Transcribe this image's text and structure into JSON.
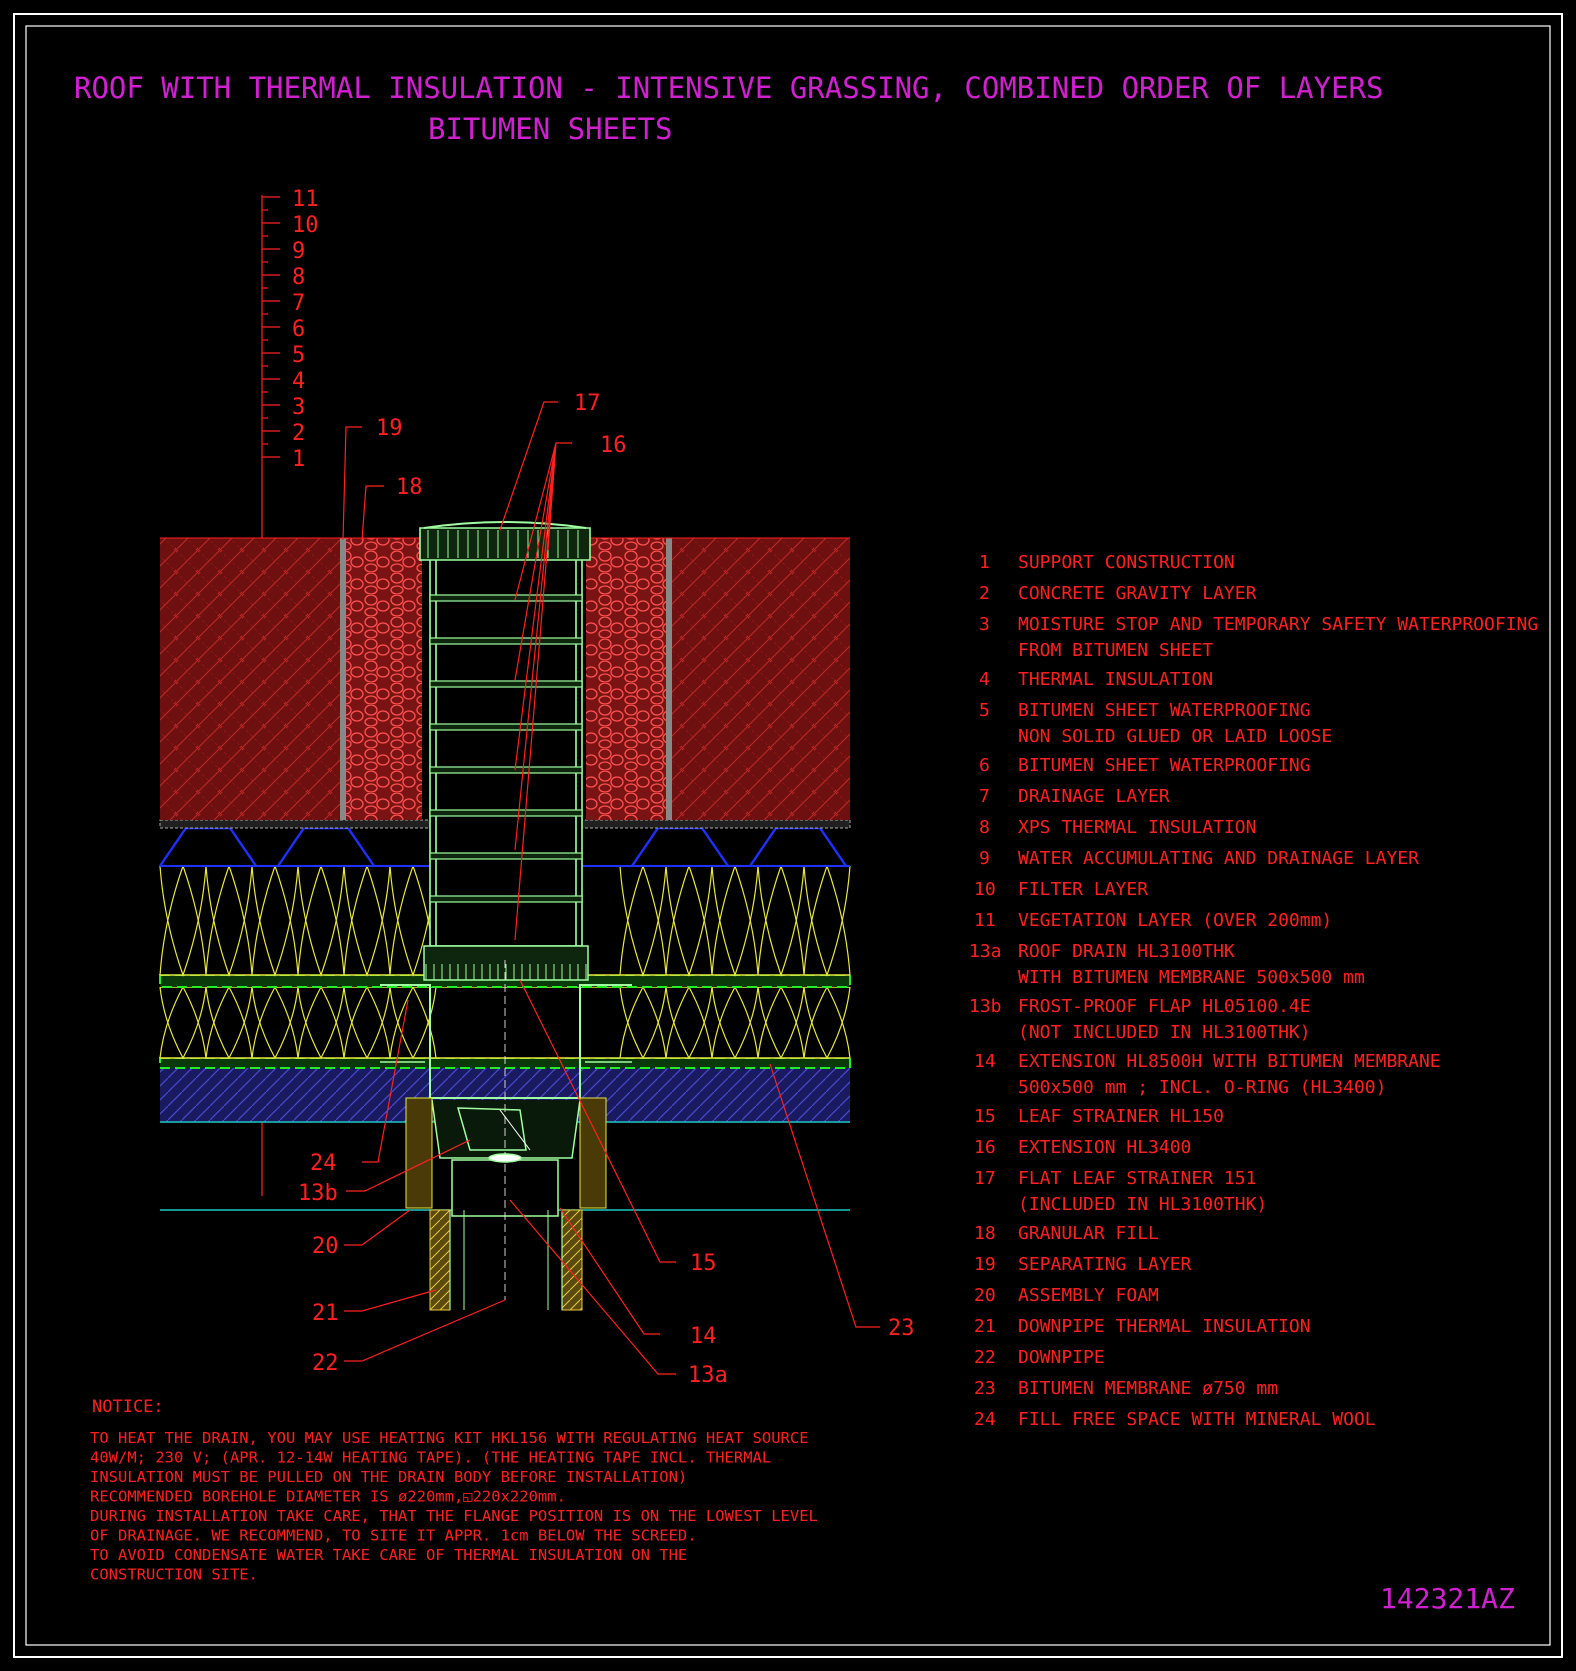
{
  "title_line1": "ROOF WITH THERMAL INSULATION - INTENSIVE GRASSING, COMBINED ORDER OF LAYERS",
  "title_line2": "BITUMEN SHEETS",
  "layer_scale_numbers": [
    "11",
    "10",
    "9",
    "8",
    "7",
    "6",
    "5",
    "4",
    "3",
    "2",
    "1"
  ],
  "callouts": {
    "c17": "17",
    "c16": "16",
    "c19": "19",
    "c18": "18",
    "c24": "24",
    "c13b": "13b",
    "c20": "20",
    "c21": "21",
    "c22": "22",
    "c15": "15",
    "c14": "14",
    "c13a": "13a",
    "c23": "23"
  },
  "legend": [
    {
      "num": "1",
      "lines": [
        "SUPPORT CONSTRUCTION"
      ]
    },
    {
      "num": "2",
      "lines": [
        "CONCRETE GRAVITY LAYER"
      ]
    },
    {
      "num": "3",
      "lines": [
        "MOISTURE STOP AND TEMPORARY SAFETY WATERPROOFING",
        "FROM BITUMEN SHEET"
      ]
    },
    {
      "num": "4",
      "lines": [
        "THERMAL INSULATION"
      ]
    },
    {
      "num": "5",
      "lines": [
        "BITUMEN SHEET WATERPROOFING",
        "NON SOLID GLUED OR LAID LOOSE"
      ]
    },
    {
      "num": "6",
      "lines": [
        "BITUMEN SHEET WATERPROOFING"
      ]
    },
    {
      "num": "7",
      "lines": [
        "DRAINAGE LAYER"
      ]
    },
    {
      "num": "8",
      "lines": [
        "XPS THERMAL INSULATION"
      ]
    },
    {
      "num": "9",
      "lines": [
        "WATER ACCUMULATING AND DRAINAGE LAYER"
      ]
    },
    {
      "num": "10",
      "lines": [
        "FILTER LAYER"
      ]
    },
    {
      "num": "11",
      "lines": [
        "VEGETATION LAYER (OVER 200mm)"
      ]
    },
    {
      "num": "13a",
      "lines": [
        "ROOF DRAIN HL3100THK",
        "WITH BITUMEN MEMBRANE 500x500 mm"
      ]
    },
    {
      "num": "13b",
      "lines": [
        "FROST-PROOF FLAP HL05100.4E",
        "(NOT INCLUDED IN HL3100THK)"
      ]
    },
    {
      "num": "14",
      "lines": [
        "EXTENSION HL8500H WITH BITUMEN MEMBRANE",
        "500x500 mm ; INCL. O-RING (HL3400)"
      ]
    },
    {
      "num": "15",
      "lines": [
        "LEAF STRAINER HL150"
      ]
    },
    {
      "num": "16",
      "lines": [
        "EXTENSION HL3400"
      ]
    },
    {
      "num": "17",
      "lines": [
        "FLAT LEAF STRAINER 151",
        "(INCLUDED IN HL3100THK)"
      ]
    },
    {
      "num": "18",
      "lines": [
        "GRANULAR FILL"
      ]
    },
    {
      "num": "19",
      "lines": [
        "SEPARATING LAYER"
      ]
    },
    {
      "num": "20",
      "lines": [
        "ASSEMBLY FOAM"
      ]
    },
    {
      "num": "21",
      "lines": [
        "DOWNPIPE THERMAL INSULATION"
      ]
    },
    {
      "num": "22",
      "lines": [
        "DOWNPIPE"
      ]
    },
    {
      "num": "23",
      "lines": [
        "BITUMEN MEMBRANE ø750 mm"
      ]
    },
    {
      "num": "24",
      "lines": [
        "FILL FREE SPACE WITH MINERAL WOOL"
      ]
    }
  ],
  "notice_heading": "NOTICE:",
  "notice_lines": [
    "TO HEAT THE DRAIN, YOU MAY USE HEATING KIT HKL156 WITH REGULATING HEAT SOURCE",
    "40W/M; 230 V;  (APR. 12-14W HEATING TAPE). (THE HEATING TAPE INCL. THERMAL",
    "INSULATION MUST BE PULLED ON THE DRAIN BODY BEFORE INSTALLATION)",
    "RECOMMENDED BOREHOLE DIAMETER IS ø220mm,◱220x220mm.",
    "DURING INSTALLATION TAKE CARE, THAT THE FLANGE POSITION IS ON THE LOWEST LEVEL",
    "OF DRAINAGE. WE RECOMMEND, TO SITE IT APPR. 1cm BELOW THE SCREED.",
    "TO AVOID CONDENSATE WATER TAKE CARE OF THERMAL INSULATION ON THE",
    "CONSTRUCTION SITE."
  ],
  "drawing_code": "142321AZ",
  "colors": {
    "background": "#000000",
    "frame": "#ffffff",
    "title": "#d020d0",
    "annotation": "#ff2020",
    "soil": "#8b1a1a",
    "insulation": "#e8e840",
    "membrane": "#22ee22",
    "drainage": "#2030ff",
    "drain_body": "#a0ffa0",
    "concrete": "#2a2a90",
    "cyan": "#20c8c8"
  }
}
